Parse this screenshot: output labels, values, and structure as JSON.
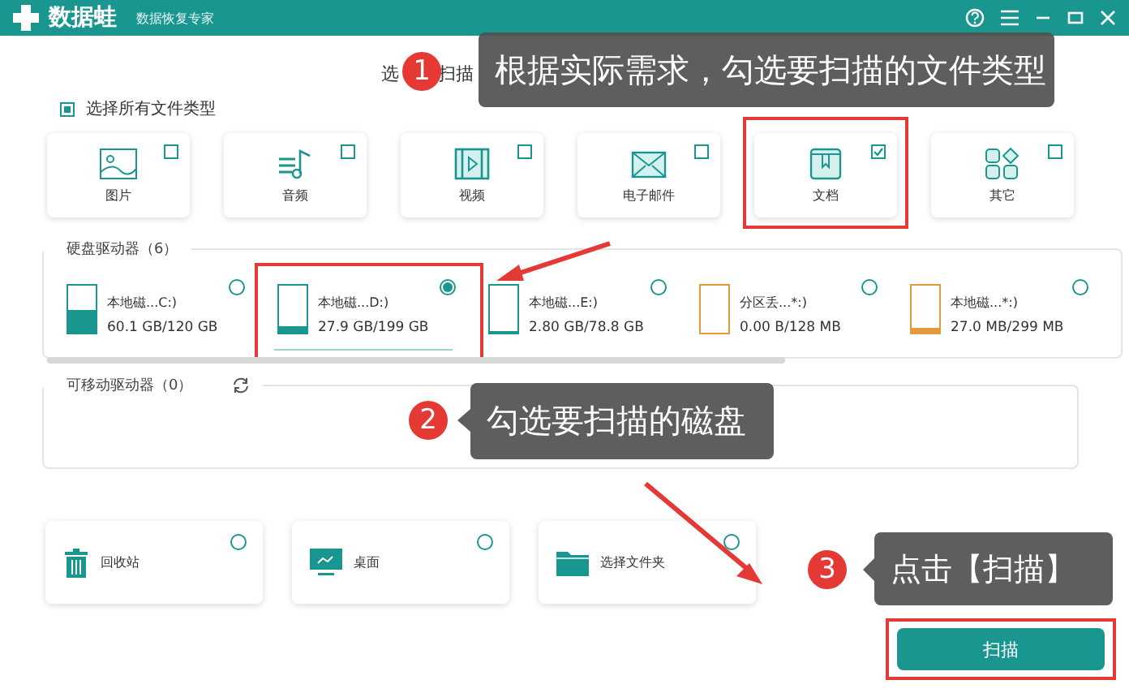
{
  "window": {
    "app_name": "数据蛙",
    "subtitle": "数据恢复专家"
  },
  "instruction_fragments": [
    "选",
    "扫描"
  ],
  "select_all": {
    "label": "选择所有文件类型",
    "checked": true
  },
  "file_types": [
    {
      "kind": "image",
      "label": "图片",
      "checked": false,
      "highlighted": false
    },
    {
      "kind": "audio",
      "label": "音频",
      "checked": false,
      "highlighted": false
    },
    {
      "kind": "video",
      "label": "视频",
      "checked": false,
      "highlighted": false
    },
    {
      "kind": "email",
      "label": "电子邮件",
      "checked": false,
      "highlighted": false
    },
    {
      "kind": "document",
      "label": "文档",
      "checked": true,
      "highlighted": true
    },
    {
      "kind": "other",
      "label": "其它",
      "checked": false,
      "highlighted": false
    }
  ],
  "hard_drives": {
    "title": "硬盘驱动器（6）",
    "drives": [
      {
        "name": "本地磁...C:)",
        "usage": "60.1 GB/120 GB",
        "level": 0.5,
        "color": "#1a9690",
        "selected": false,
        "highlighted": false
      },
      {
        "name": "本地磁...D:)",
        "usage": "27.9 GB/199 GB",
        "level": 0.14,
        "color": "#1a9690",
        "selected": true,
        "highlighted": true
      },
      {
        "name": "本地磁...E:)",
        "usage": "2.80 GB/78.8 GB",
        "level": 0.04,
        "color": "#1a9690",
        "selected": false,
        "highlighted": false
      },
      {
        "name": "分区丢...*:)",
        "usage": "0.00  B/128 MB",
        "level": 0,
        "color": "#e39a3b",
        "selected": false,
        "highlighted": false
      },
      {
        "name": "本地磁...*:)",
        "usage": "27.0 MB/299 MB",
        "level": 0.1,
        "color": "#e39a3b",
        "selected": false,
        "highlighted": false
      }
    ]
  },
  "removable_drives": {
    "title": "可移动驱动器（0）"
  },
  "locations": [
    {
      "kind": "recycle_bin",
      "label": "回收站",
      "selected": false
    },
    {
      "kind": "desktop",
      "label": "桌面",
      "selected": false
    },
    {
      "kind": "folder",
      "label": "选择文件夹",
      "selected": false
    }
  ],
  "scan_button": {
    "label": "扫描",
    "highlighted": true
  },
  "annotations": [
    {
      "number": "1",
      "text": "根据实际需求，勾选要扫描的文件类型"
    },
    {
      "number": "2",
      "text": "勾选要扫描的磁盘"
    },
    {
      "number": "3",
      "text": "点击【扫描】"
    }
  ]
}
